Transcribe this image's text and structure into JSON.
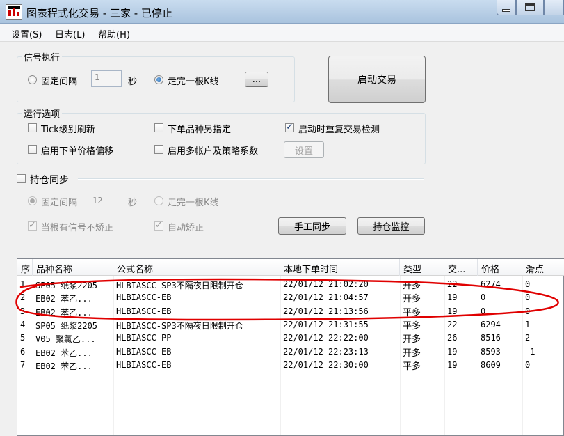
{
  "window": {
    "title": "图表程式化交易 - 三家 - 已停止",
    "icon": "chart-app-icon"
  },
  "menu": [
    {
      "label": "设置(S)"
    },
    {
      "label": "日志(L)"
    },
    {
      "label": "帮助(H)"
    }
  ],
  "signal": {
    "group_title": "信号执行",
    "fixed_interval_label": "固定间隔",
    "interval_value": "1",
    "seconds_label": "秒",
    "bar_complete_label": "走完一根K线",
    "more_button": "...",
    "fixed_interval_checked": false,
    "bar_complete_checked": true
  },
  "start_button": "启动交易",
  "run_options": {
    "group_title": "运行选项",
    "tick_refresh": "Tick级别刷新",
    "order_variety": "下单品种另指定",
    "restart_check": "启动时重复交易检测",
    "price_offset": "启用下单价格偏移",
    "multi_account": "启用多帐户及策略系数",
    "settings_button": "设置",
    "restart_check_checked": true
  },
  "position_sync": {
    "title": "持仓同步",
    "fixed_interval_label": "固定间隔",
    "interval_value": "12",
    "seconds_label": "秒",
    "bar_complete_label": "走完一根K线",
    "no_correct_label": "当根有信号不矫正",
    "auto_correct_label": "自动矫正",
    "manual_sync_button": "手工同步",
    "monitor_button": "持仓监控"
  },
  "table": {
    "headers": [
      "序",
      "品种名称",
      "公式名称",
      "本地下单时间",
      "类型",
      "交易",
      "价格",
      "滑点"
    ],
    "header_display": [
      "序",
      "品种名称",
      "公式名称",
      "本地下单时间",
      "类型",
      "交...",
      "价格",
      "滑点"
    ],
    "rows": [
      [
        "1",
        "SP05 纸浆2205",
        "HLBIASCC-SP3不隔夜日限制开仓",
        "22/01/12 21:02:20",
        "开多",
        "22",
        "6274",
        "0"
      ],
      [
        "2",
        "EB02 苯乙...",
        "HLBIASCC-EB",
        "22/01/12 21:04:57",
        "开多",
        "19",
        "0",
        "0"
      ],
      [
        "3",
        "EB02 苯乙...",
        "HLBIASCC-EB",
        "22/01/12 21:13:56",
        "平多",
        "19",
        "0",
        "0"
      ],
      [
        "4",
        "SP05 纸浆2205",
        "HLBIASCC-SP3不隔夜日限制开仓",
        "22/01/12 21:31:55",
        "平多",
        "22",
        "6294",
        "1"
      ],
      [
        "5",
        "V05 聚氯乙...",
        "HLBIASCC-PP",
        "22/01/12 22:22:00",
        "开多",
        "26",
        "8516",
        "2"
      ],
      [
        "6",
        "EB02 苯乙...",
        "HLBIASCC-EB",
        "22/01/12 22:23:13",
        "开多",
        "19",
        "8593",
        "-1"
      ],
      [
        "7",
        "EB02 苯乙...",
        "HLBIASCC-EB",
        "22/01/12 22:30:00",
        "平多",
        "19",
        "8609",
        "0"
      ]
    ]
  },
  "colors": {
    "annotation": "#e00000",
    "titlebar": "#b9d1ea",
    "background": "#f0f0f0"
  }
}
